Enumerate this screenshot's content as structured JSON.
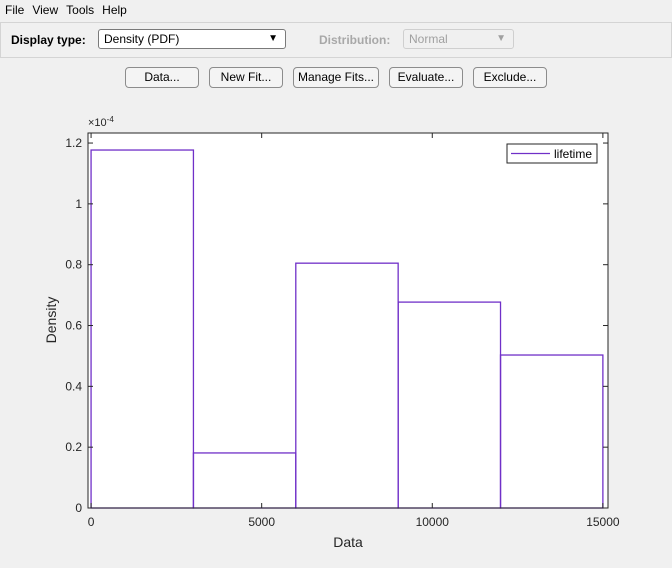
{
  "menu": [
    "File",
    "View",
    "Tools",
    "Help"
  ],
  "display_type": {
    "label": "Display type:",
    "value": "Density (PDF)"
  },
  "distribution": {
    "label": "Distribution:",
    "value": "Normal",
    "disabled": true
  },
  "buttons": [
    "Data...",
    "New Fit...",
    "Manage Fits...",
    "Evaluate...",
    "Exclude..."
  ],
  "chart_data": {
    "type": "bar",
    "bin_edges": [
      0,
      3000,
      6000,
      9000,
      12000,
      15000
    ],
    "values": [
      0.0001177,
      1.81e-05,
      8.05e-05,
      6.77e-05,
      5.03e-05
    ],
    "xlabel": "Data",
    "ylabel": "Density",
    "exponent_label": "×10",
    "exponent": "-4",
    "xlim": [
      -90,
      15150
    ],
    "ylim": [
      0,
      1.233
    ],
    "xticks": [
      "0",
      "5000",
      "10000",
      "15000"
    ],
    "xtick_values": [
      0,
      5000,
      10000,
      15000
    ],
    "yticks": [
      "0",
      "0.2",
      "0.4",
      "0.6",
      "0.8",
      "1",
      "1.2"
    ],
    "ytick_values": [
      0,
      0.2,
      0.4,
      0.6,
      0.8,
      1,
      1.2
    ],
    "series": [
      {
        "name": "lifetime",
        "color": "#7030c8"
      }
    ],
    "legend": "top-right",
    "grid": false
  }
}
